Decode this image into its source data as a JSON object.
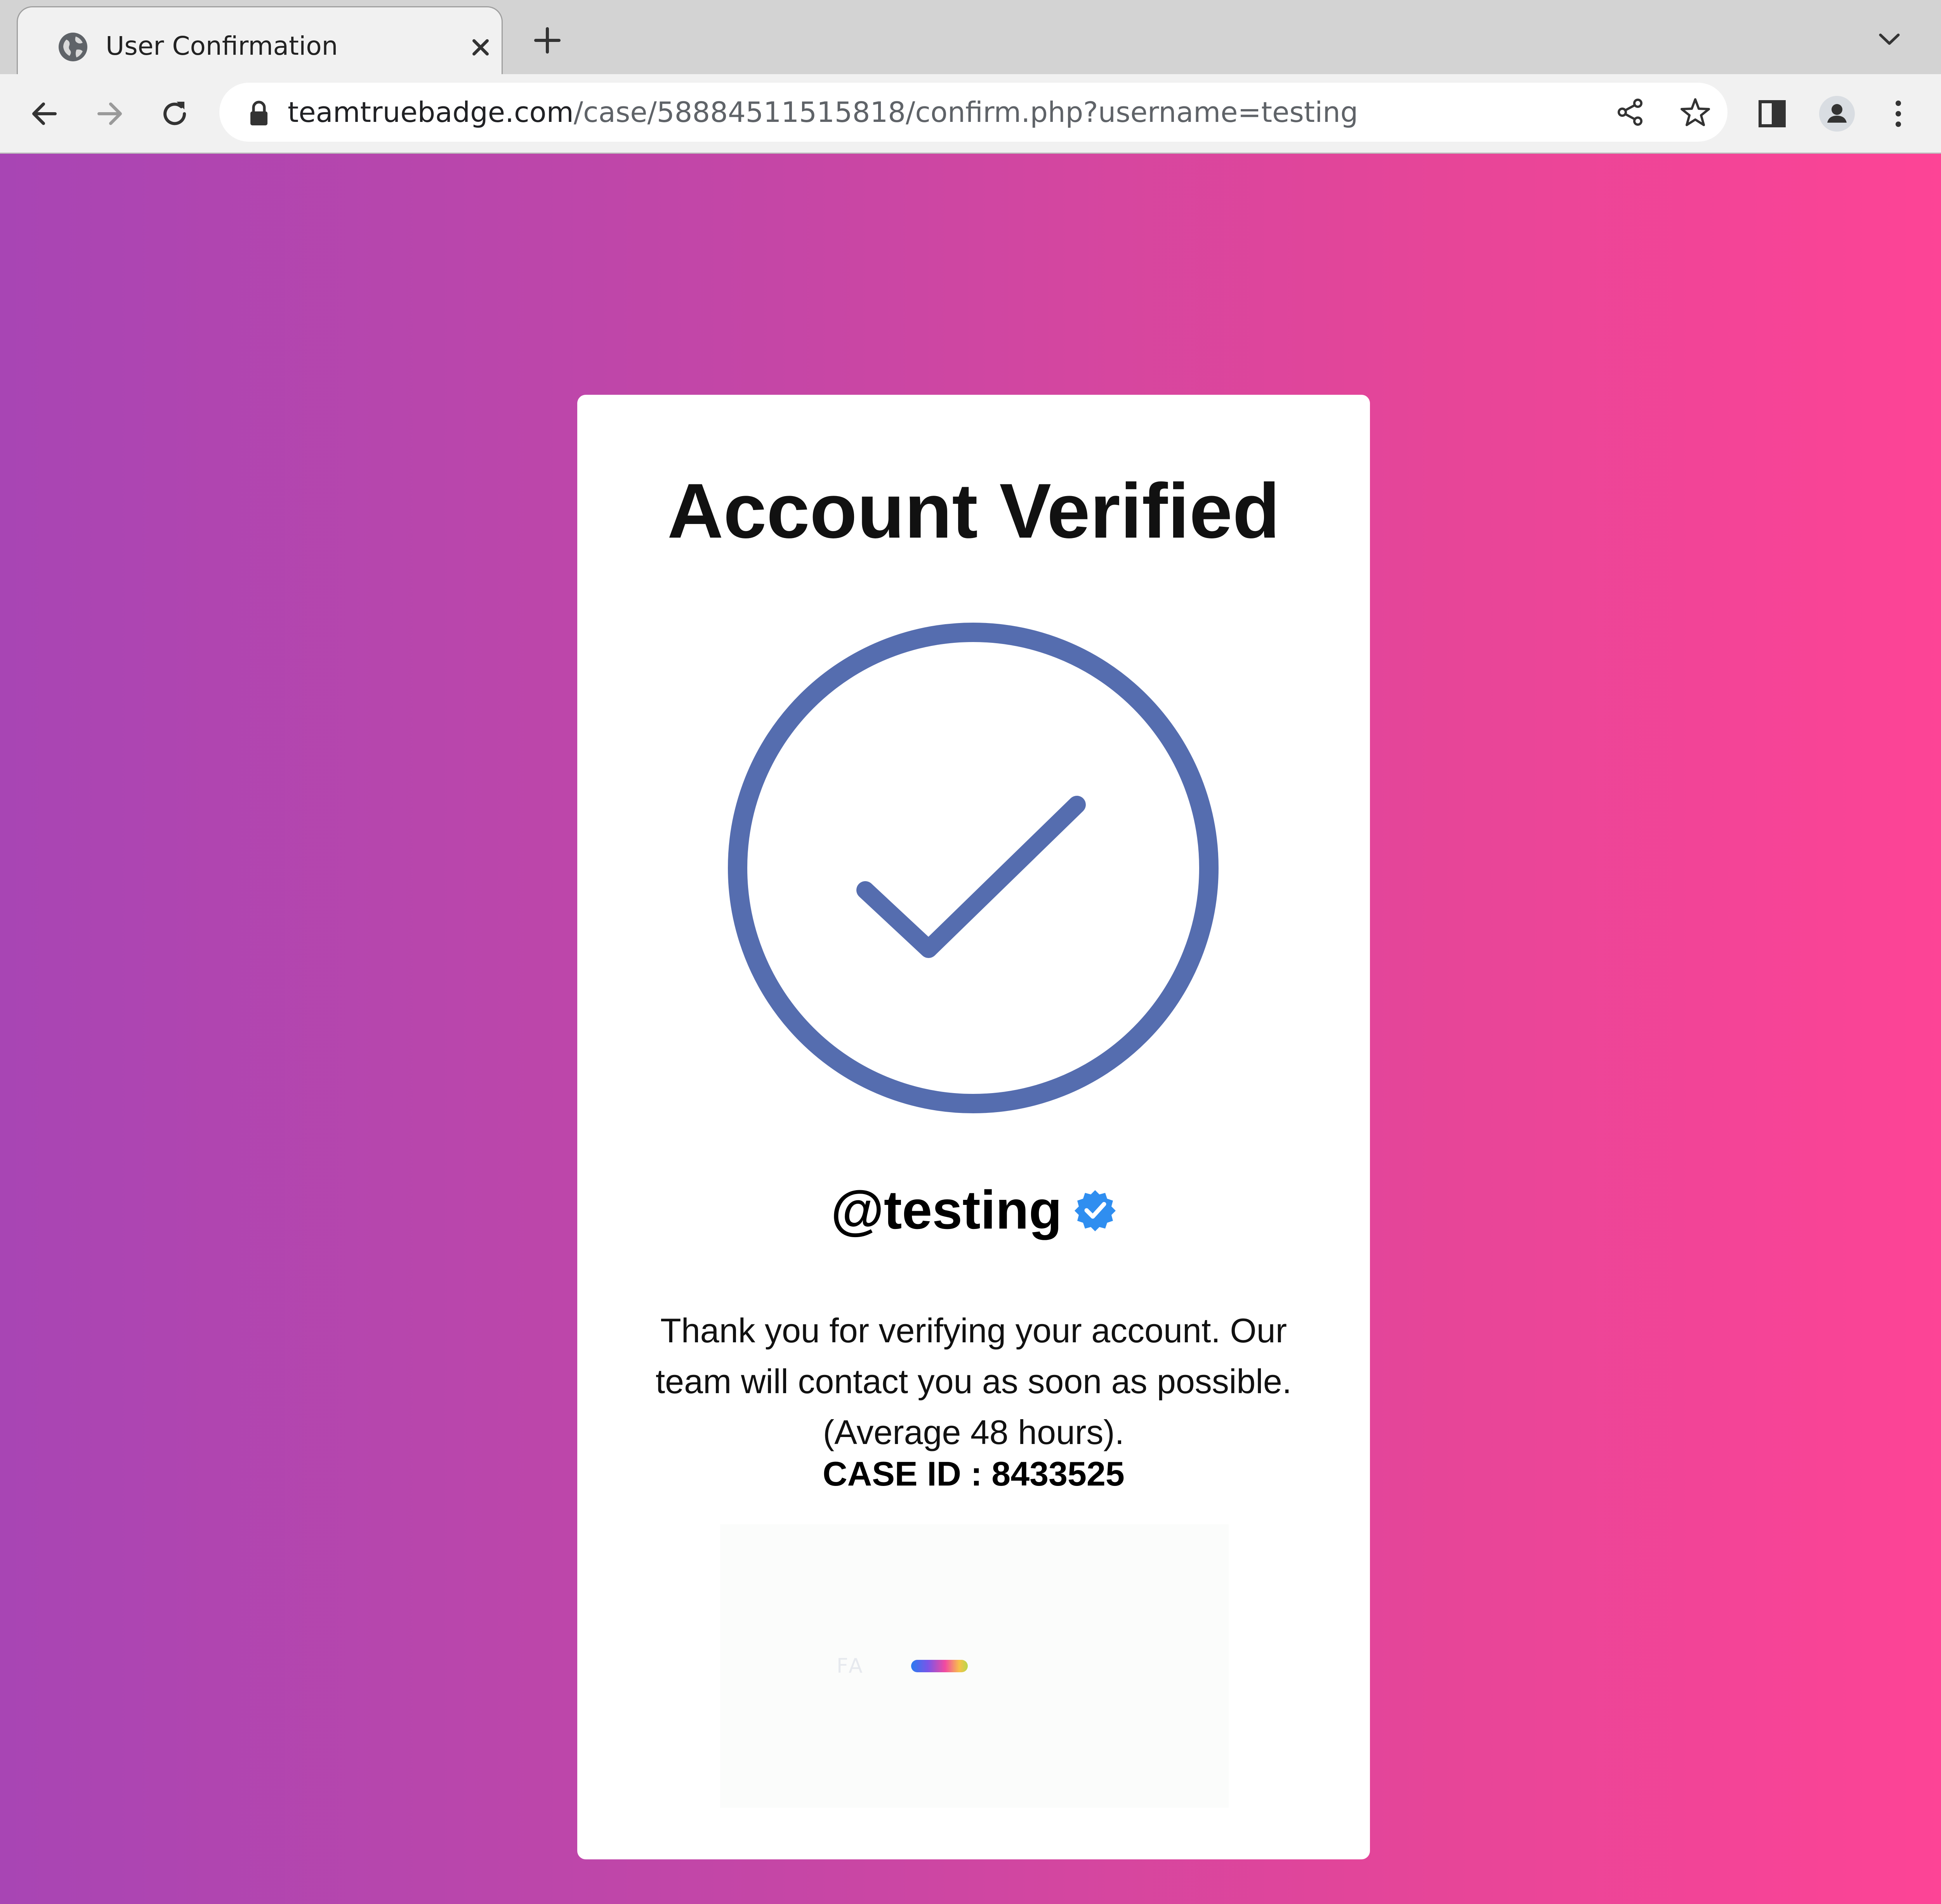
{
  "browser": {
    "tab": {
      "title": "User Confirmation",
      "favicon": "globe-icon"
    },
    "address_bar": {
      "host": "teamtruebadge.com",
      "path": "/case/58884511515818/confirm.php?username=testing",
      "secure_icon": "lock-icon"
    },
    "icons": {
      "back": "arrow-left-icon",
      "forward": "arrow-right-icon",
      "reload": "reload-icon",
      "share": "share-icon",
      "bookmark": "star-icon",
      "side_panel": "side-panel-icon",
      "profile": "profile-icon",
      "menu": "kebab-menu-icon",
      "new_tab": "plus-icon",
      "tab_search": "chevron-down-icon",
      "close_tab": "close-icon"
    }
  },
  "page": {
    "background_gradient": [
      "#a845b4",
      "#fd4496"
    ],
    "card": {
      "title": "Account Verified",
      "check_icon": "check-circle-icon",
      "check_color": "#556daf",
      "username": "@testing",
      "badge_icon": "verified-badge-icon",
      "badge_color": "#2f8ef0",
      "message": "Thank you for verifying your account. Our team will contact you as soon as possible. (Average 48 hours).",
      "case_id": "CASE ID : 8433525",
      "loader": {
        "text": "FA"
      }
    }
  }
}
